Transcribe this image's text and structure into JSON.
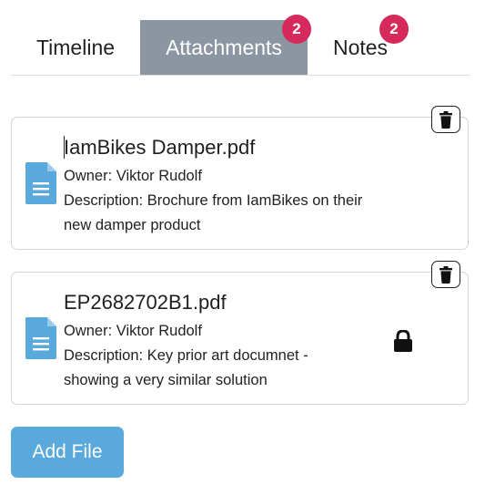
{
  "tabs": [
    {
      "label": "Timeline"
    },
    {
      "label": "Attachments",
      "badge": "2"
    },
    {
      "label": "Notes",
      "badge": "2"
    }
  ],
  "attachments": [
    {
      "name": "IamBikes Damper.pdf",
      "owner": "Owner: Viktor Rudolf",
      "description_line1": "Description: Brochure from IamBikes on their",
      "description_line2": "new damper product",
      "locked": false
    },
    {
      "name": "EP2682702B1.pdf",
      "owner": "Owner: Viktor Rudolf",
      "description_line1": "Description: Key prior art documnet -",
      "description_line2": "showing a very similar solution",
      "locked": true
    }
  ],
  "add_button_label": "Add File",
  "icons": {
    "file": "file-document-icon",
    "delete": "trash-icon",
    "lock": "lock-icon"
  },
  "colors": {
    "active_tab": "#8c96a3",
    "badge": "#d52a5b",
    "file_icon": "#5aa9dc",
    "add_button": "#5aa9dc"
  }
}
